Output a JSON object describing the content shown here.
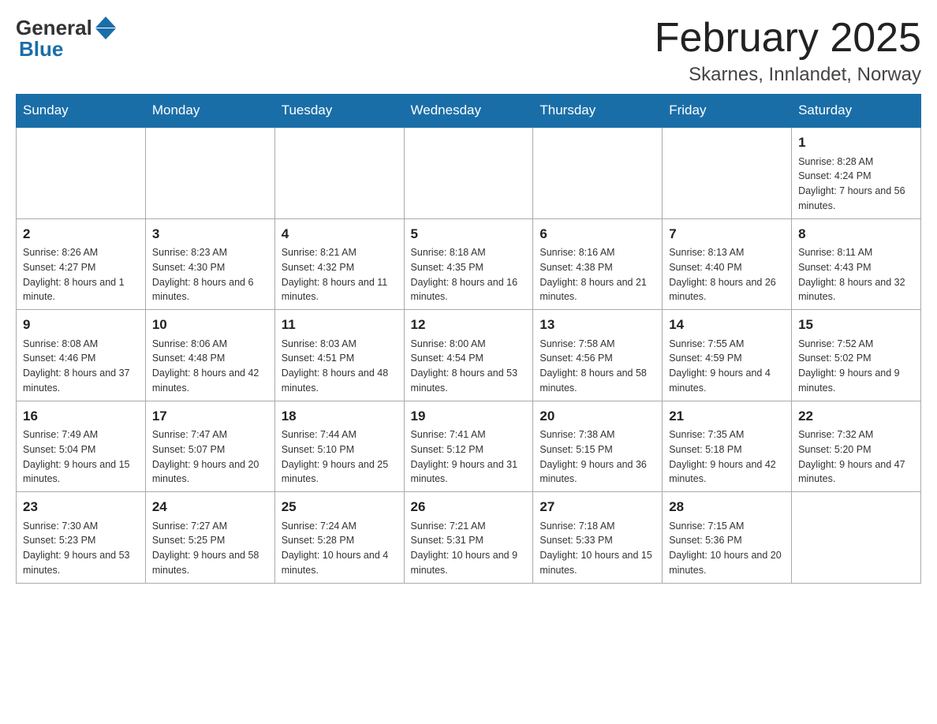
{
  "header": {
    "logo_general": "General",
    "logo_blue": "Blue",
    "title": "February 2025",
    "subtitle": "Skarnes, Innlandet, Norway"
  },
  "weekdays": [
    "Sunday",
    "Monday",
    "Tuesday",
    "Wednesday",
    "Thursday",
    "Friday",
    "Saturday"
  ],
  "weeks": [
    [
      {
        "day": "",
        "info": ""
      },
      {
        "day": "",
        "info": ""
      },
      {
        "day": "",
        "info": ""
      },
      {
        "day": "",
        "info": ""
      },
      {
        "day": "",
        "info": ""
      },
      {
        "day": "",
        "info": ""
      },
      {
        "day": "1",
        "info": "Sunrise: 8:28 AM\nSunset: 4:24 PM\nDaylight: 7 hours and 56 minutes."
      }
    ],
    [
      {
        "day": "2",
        "info": "Sunrise: 8:26 AM\nSunset: 4:27 PM\nDaylight: 8 hours and 1 minute."
      },
      {
        "day": "3",
        "info": "Sunrise: 8:23 AM\nSunset: 4:30 PM\nDaylight: 8 hours and 6 minutes."
      },
      {
        "day": "4",
        "info": "Sunrise: 8:21 AM\nSunset: 4:32 PM\nDaylight: 8 hours and 11 minutes."
      },
      {
        "day": "5",
        "info": "Sunrise: 8:18 AM\nSunset: 4:35 PM\nDaylight: 8 hours and 16 minutes."
      },
      {
        "day": "6",
        "info": "Sunrise: 8:16 AM\nSunset: 4:38 PM\nDaylight: 8 hours and 21 minutes."
      },
      {
        "day": "7",
        "info": "Sunrise: 8:13 AM\nSunset: 4:40 PM\nDaylight: 8 hours and 26 minutes."
      },
      {
        "day": "8",
        "info": "Sunrise: 8:11 AM\nSunset: 4:43 PM\nDaylight: 8 hours and 32 minutes."
      }
    ],
    [
      {
        "day": "9",
        "info": "Sunrise: 8:08 AM\nSunset: 4:46 PM\nDaylight: 8 hours and 37 minutes."
      },
      {
        "day": "10",
        "info": "Sunrise: 8:06 AM\nSunset: 4:48 PM\nDaylight: 8 hours and 42 minutes."
      },
      {
        "day": "11",
        "info": "Sunrise: 8:03 AM\nSunset: 4:51 PM\nDaylight: 8 hours and 48 minutes."
      },
      {
        "day": "12",
        "info": "Sunrise: 8:00 AM\nSunset: 4:54 PM\nDaylight: 8 hours and 53 minutes."
      },
      {
        "day": "13",
        "info": "Sunrise: 7:58 AM\nSunset: 4:56 PM\nDaylight: 8 hours and 58 minutes."
      },
      {
        "day": "14",
        "info": "Sunrise: 7:55 AM\nSunset: 4:59 PM\nDaylight: 9 hours and 4 minutes."
      },
      {
        "day": "15",
        "info": "Sunrise: 7:52 AM\nSunset: 5:02 PM\nDaylight: 9 hours and 9 minutes."
      }
    ],
    [
      {
        "day": "16",
        "info": "Sunrise: 7:49 AM\nSunset: 5:04 PM\nDaylight: 9 hours and 15 minutes."
      },
      {
        "day": "17",
        "info": "Sunrise: 7:47 AM\nSunset: 5:07 PM\nDaylight: 9 hours and 20 minutes."
      },
      {
        "day": "18",
        "info": "Sunrise: 7:44 AM\nSunset: 5:10 PM\nDaylight: 9 hours and 25 minutes."
      },
      {
        "day": "19",
        "info": "Sunrise: 7:41 AM\nSunset: 5:12 PM\nDaylight: 9 hours and 31 minutes."
      },
      {
        "day": "20",
        "info": "Sunrise: 7:38 AM\nSunset: 5:15 PM\nDaylight: 9 hours and 36 minutes."
      },
      {
        "day": "21",
        "info": "Sunrise: 7:35 AM\nSunset: 5:18 PM\nDaylight: 9 hours and 42 minutes."
      },
      {
        "day": "22",
        "info": "Sunrise: 7:32 AM\nSunset: 5:20 PM\nDaylight: 9 hours and 47 minutes."
      }
    ],
    [
      {
        "day": "23",
        "info": "Sunrise: 7:30 AM\nSunset: 5:23 PM\nDaylight: 9 hours and 53 minutes."
      },
      {
        "day": "24",
        "info": "Sunrise: 7:27 AM\nSunset: 5:25 PM\nDaylight: 9 hours and 58 minutes."
      },
      {
        "day": "25",
        "info": "Sunrise: 7:24 AM\nSunset: 5:28 PM\nDaylight: 10 hours and 4 minutes."
      },
      {
        "day": "26",
        "info": "Sunrise: 7:21 AM\nSunset: 5:31 PM\nDaylight: 10 hours and 9 minutes."
      },
      {
        "day": "27",
        "info": "Sunrise: 7:18 AM\nSunset: 5:33 PM\nDaylight: 10 hours and 15 minutes."
      },
      {
        "day": "28",
        "info": "Sunrise: 7:15 AM\nSunset: 5:36 PM\nDaylight: 10 hours and 20 minutes."
      },
      {
        "day": "",
        "info": ""
      }
    ]
  ]
}
